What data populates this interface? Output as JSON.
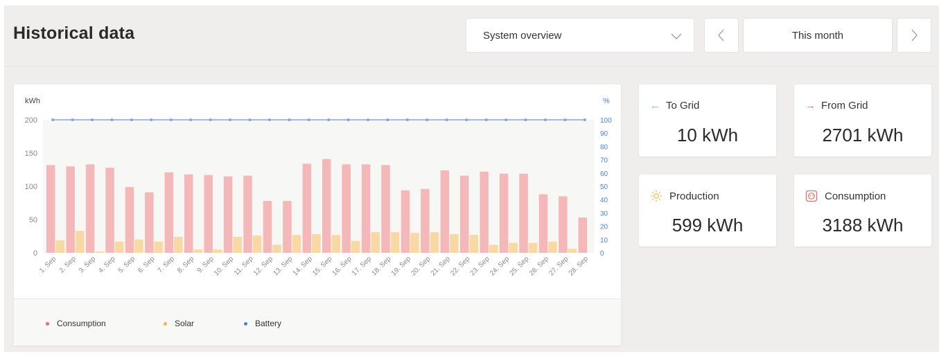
{
  "header": {
    "title": "Historical data",
    "view_select": "System overview",
    "period": "This month"
  },
  "icons": {
    "view_select_chevron": "chevron-down-icon",
    "prev": "chevron-left-icon",
    "next": "chevron-right-icon",
    "to_grid": "arrow-left-icon",
    "from_grid": "arrow-right-icon",
    "production": "sun-icon",
    "consumption": "outlet-icon"
  },
  "colors": {
    "consumption": "#f4b8b8",
    "solar": "#f8d9a3",
    "battery": "#7fa6dd",
    "grid_in": "#7cc47e",
    "grid_out": "#e46d6d",
    "production": "#f2b04f",
    "consumption_icon": "#e46d6d"
  },
  "stats": {
    "to_grid": {
      "label": "To Grid",
      "value": "10 kWh"
    },
    "from_grid": {
      "label": "From Grid",
      "value": "2701 kWh"
    },
    "production": {
      "label": "Production",
      "value": "599 kWh"
    },
    "consumption": {
      "label": "Consumption",
      "value": "3188 kWh"
    }
  },
  "legend": [
    "Consumption",
    "Solar",
    "Battery"
  ],
  "chart_data": {
    "type": "bar",
    "ylabel": "kWh",
    "y2label": "%",
    "ylim": [
      0,
      200
    ],
    "y2lim": [
      0,
      100
    ],
    "yticks": [
      0,
      50,
      100,
      150,
      200
    ],
    "y2ticks": [
      0,
      10,
      20,
      30,
      40,
      50,
      60,
      70,
      80,
      90,
      100
    ],
    "grid": false,
    "legend_position": "bottom",
    "categories": [
      "1. Sep",
      "2. Sep",
      "3. Sep",
      "4. Sep",
      "5. Sep",
      "6. Sep",
      "7. Sep",
      "8. Sep",
      "9. Sep",
      "10. Sep",
      "11. Sep",
      "12. Sep",
      "13. Sep",
      "14. Sep",
      "15. Sep",
      "16. Sep",
      "17. Sep",
      "18. Sep",
      "19. Sep",
      "20. Sep",
      "21. Sep",
      "22. Sep",
      "23. Sep",
      "24. Sep",
      "25. Sep",
      "26. Sep",
      "27. Sep",
      "28. Sep"
    ],
    "series": [
      {
        "name": "Consumption",
        "axis": "left",
        "values": [
          132,
          130,
          133,
          128,
          99,
          91,
          121,
          118,
          117,
          115,
          116,
          78,
          78,
          134,
          141,
          133,
          133,
          132,
          94,
          96,
          124,
          116,
          122,
          119,
          119,
          88,
          85,
          53
        ]
      },
      {
        "name": "Solar",
        "axis": "left",
        "values": [
          19,
          33,
          2,
          17,
          20,
          17,
          24,
          5,
          5,
          24,
          26,
          12,
          27,
          28,
          27,
          18,
          31,
          31,
          30,
          31,
          28,
          27,
          12,
          15,
          15,
          17,
          6,
          0
        ]
      },
      {
        "name": "Battery",
        "axis": "right",
        "values": [
          100,
          100,
          100,
          100,
          100,
          100,
          100,
          100,
          100,
          100,
          100,
          100,
          100,
          100,
          100,
          100,
          100,
          100,
          100,
          100,
          100,
          100,
          100,
          100,
          100,
          100,
          100,
          100
        ]
      }
    ]
  }
}
